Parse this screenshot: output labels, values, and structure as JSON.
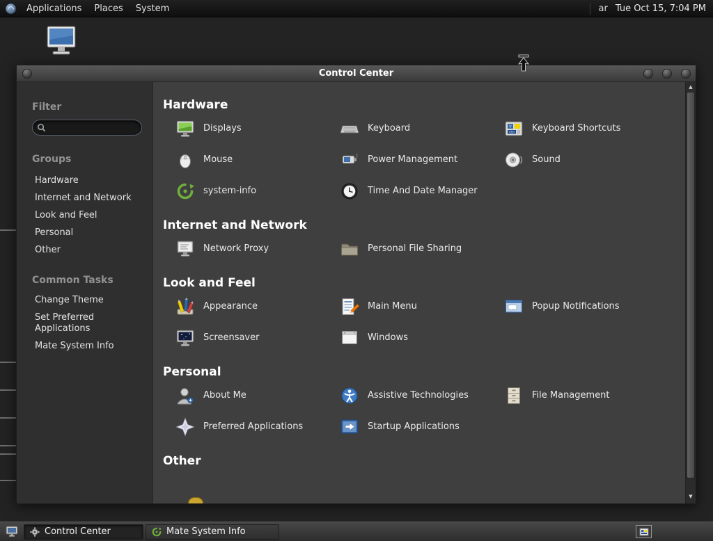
{
  "top_panel": {
    "menus": [
      {
        "label": "Applications"
      },
      {
        "label": "Places"
      },
      {
        "label": "System"
      }
    ],
    "keyboard_indicator": "ar",
    "clock": "Tue Oct 15, 7:04 PM"
  },
  "window": {
    "title": "Control Center",
    "sidebar": {
      "filter_label": "Filter",
      "search": {
        "value": "",
        "placeholder": ""
      },
      "groups_label": "Groups",
      "groups": [
        "Hardware",
        "Internet and Network",
        "Look and Feel",
        "Personal",
        "Other"
      ],
      "common_tasks_label": "Common Tasks",
      "common_tasks": [
        "Change Theme",
        "Set Preferred Applications",
        "Mate System Info"
      ]
    },
    "sections": [
      {
        "title": "Hardware",
        "items": [
          {
            "label": "Displays",
            "icon": "displays-icon"
          },
          {
            "label": "Keyboard",
            "icon": "keyboard-icon"
          },
          {
            "label": "Keyboard Shortcuts",
            "icon": "keyboard-shortcuts-icon"
          },
          {
            "label": "Mouse",
            "icon": "mouse-icon"
          },
          {
            "label": "Power Management",
            "icon": "power-management-icon"
          },
          {
            "label": "Sound",
            "icon": "sound-icon"
          },
          {
            "label": "system-info",
            "icon": "system-info-icon"
          },
          {
            "label": "Time And Date Manager",
            "icon": "time-date-icon"
          }
        ]
      },
      {
        "title": "Internet and Network",
        "items": [
          {
            "label": "Network Proxy",
            "icon": "network-proxy-icon"
          },
          {
            "label": "Personal File Sharing",
            "icon": "personal-file-sharing-icon"
          }
        ]
      },
      {
        "title": "Look and Feel",
        "items": [
          {
            "label": "Appearance",
            "icon": "appearance-icon"
          },
          {
            "label": "Main Menu",
            "icon": "main-menu-icon"
          },
          {
            "label": "Popup Notifications",
            "icon": "popup-notifications-icon"
          },
          {
            "label": "Screensaver",
            "icon": "screensaver-icon"
          },
          {
            "label": "Windows",
            "icon": "windows-icon"
          }
        ]
      },
      {
        "title": "Personal",
        "items": [
          {
            "label": "About Me",
            "icon": "about-me-icon"
          },
          {
            "label": "Assistive Technologies",
            "icon": "assistive-technologies-icon"
          },
          {
            "label": "File Management",
            "icon": "file-management-icon"
          },
          {
            "label": "Preferred Applications",
            "icon": "preferred-applications-icon"
          },
          {
            "label": "Startup Applications",
            "icon": "startup-applications-icon"
          }
        ]
      },
      {
        "title": "Other",
        "items": []
      }
    ]
  },
  "taskbar": {
    "tasks": [
      {
        "label": "Control Center",
        "icon": "control-center-icon",
        "active": true
      },
      {
        "label": "Mate System Info",
        "icon": "system-info-icon",
        "active": false
      }
    ]
  },
  "colors": {
    "panel_bg": "#151515",
    "desktop_bg": "#232323",
    "window_bg": "#3f3f3f",
    "sidebar_bg": "#2f2f2f",
    "accent_blue": "#3465a4",
    "accent_green": "#6faf3c"
  }
}
